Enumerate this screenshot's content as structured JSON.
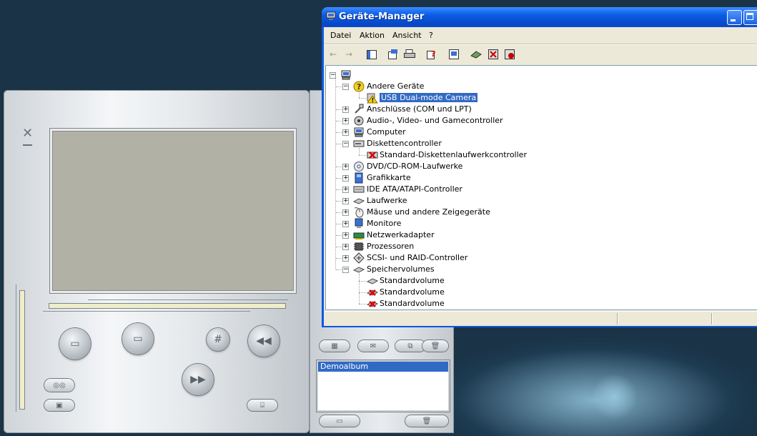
{
  "window": {
    "title": "Geräte-Manager"
  },
  "menu": [
    "Datei",
    "Aktion",
    "Ansicht",
    "?"
  ],
  "toolbar_icons": [
    "back-icon",
    "forward-icon",
    "console-tree-icon",
    "properties-icon",
    "print-icon",
    "help-icon",
    "scan-icon",
    "update-driver-icon",
    "uninstall-icon",
    "disable-icon"
  ],
  "tree": {
    "root_icon": "computer-icon",
    "items": [
      {
        "label": "Andere Geräte",
        "expanded": true,
        "icon": "question-icon",
        "children": [
          {
            "label": "USB Dual-mode Camera",
            "icon": "warning-icon",
            "selected": true
          }
        ]
      },
      {
        "label": "Anschlüsse (COM und LPT)",
        "icon": "port-icon"
      },
      {
        "label": "Audio-, Video- und Gamecontroller",
        "icon": "audio-icon"
      },
      {
        "label": "Computer",
        "icon": "computer-icon"
      },
      {
        "label": "Diskettencontroller",
        "expanded": true,
        "icon": "floppy-controller-icon",
        "children": [
          {
            "label": "Standard-Diskettenlaufwerkcontroller",
            "icon": "disabled-device-icon"
          }
        ]
      },
      {
        "label": "DVD/CD-ROM-Laufwerke",
        "icon": "cdrom-icon"
      },
      {
        "label": "Grafikkarte",
        "icon": "display-adapter-icon"
      },
      {
        "label": "IDE ATA/ATAPI-Controller",
        "icon": "ide-icon"
      },
      {
        "label": "Laufwerke",
        "icon": "disk-icon"
      },
      {
        "label": "Mäuse und andere Zeigegeräte",
        "icon": "mouse-icon"
      },
      {
        "label": "Monitore",
        "icon": "monitor-icon"
      },
      {
        "label": "Netzwerkadapter",
        "icon": "network-icon"
      },
      {
        "label": "Prozessoren",
        "icon": "cpu-icon"
      },
      {
        "label": "SCSI- und RAID-Controller",
        "icon": "scsi-icon"
      },
      {
        "label": "Speichervolumes",
        "expanded": true,
        "icon": "volume-icon",
        "children": [
          {
            "label": "Standardvolume",
            "icon": "volume-icon"
          },
          {
            "label": "Standardvolume",
            "icon": "volume-error-icon"
          },
          {
            "label": "Standardvolume",
            "icon": "volume-error-icon"
          }
        ]
      }
    ]
  },
  "camera_app": {
    "album": {
      "items": [
        "Demoalbum"
      ]
    },
    "colors": {
      "screen": "#b2b1a6",
      "accent": "#316ac5",
      "slider": "#efeecb"
    }
  }
}
